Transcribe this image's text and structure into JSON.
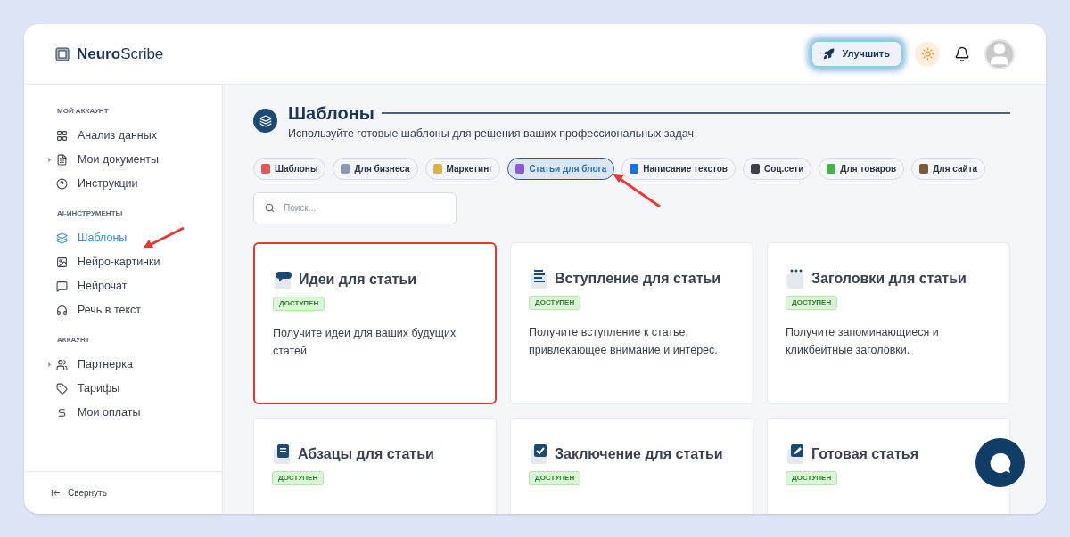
{
  "logo": {
    "bold": "Neuro",
    "light": "Scribe"
  },
  "header": {
    "upgrade_button": "Улучшить"
  },
  "sidebar": {
    "sections": [
      {
        "title": "МОЙ АККАУНТ",
        "items": [
          {
            "label": "Анализ данных",
            "kind": "grid",
            "expandable": false,
            "selected": false
          },
          {
            "label": "Мои документы",
            "kind": "doc",
            "expandable": true,
            "selected": false
          },
          {
            "label": "Инструкции",
            "kind": "help",
            "expandable": false,
            "selected": false
          }
        ]
      },
      {
        "title": "AI-ИНСТРУМЕНТЫ",
        "items": [
          {
            "label": "Шаблоны",
            "kind": "layers",
            "expandable": false,
            "selected": true
          },
          {
            "label": "Нейро-картинки",
            "kind": "image",
            "expandable": false,
            "selected": false
          },
          {
            "label": "Нейрочат",
            "kind": "chat",
            "expandable": false,
            "selected": false
          },
          {
            "label": "Речь в текст",
            "kind": "headphones",
            "expandable": false,
            "selected": false
          }
        ]
      },
      {
        "title": "АККАУНТ",
        "items": [
          {
            "label": "Партнерка",
            "kind": "users",
            "expandable": true,
            "selected": false
          },
          {
            "label": "Тарифы",
            "kind": "tag",
            "expandable": false,
            "selected": false
          },
          {
            "label": "Мои оплаты",
            "kind": "dollar",
            "expandable": false,
            "selected": false
          }
        ]
      }
    ],
    "collapse": "Свернуть"
  },
  "page": {
    "title": "Шаблоны",
    "subtitle": "Используйте готовые шаблоны для решения ваших профессиональных задач"
  },
  "categories": [
    {
      "label": "Шаблоны",
      "color": "#e05a5a",
      "selected": false
    },
    {
      "label": "Для бизнеса",
      "color": "#8a9bb0",
      "selected": false
    },
    {
      "label": "Маркетинг",
      "color": "#d9b24a",
      "selected": false
    },
    {
      "label": "Статьи для блога",
      "color": "#8e5bc9",
      "selected": true
    },
    {
      "label": "Написание текстов",
      "color": "#1e6fd9",
      "selected": false
    },
    {
      "label": "Соц.сети",
      "color": "#3a3f4a",
      "selected": false
    },
    {
      "label": "Для товаров",
      "color": "#4caf50",
      "selected": false
    },
    {
      "label": "Для сайта",
      "color": "#7a5a3a",
      "selected": false
    }
  ],
  "search": {
    "placeholder": "Поиск..."
  },
  "cards": [
    {
      "title": "Идеи для статьи",
      "kind": "bubble",
      "badge": "ДОСТУПЕН",
      "description": "Получите идеи для ваших будущих статей",
      "highlighted": true
    },
    {
      "title": "Вступление для статьи",
      "kind": "lines",
      "badge": "ДОСТУПЕН",
      "description": "Получите вступление к статье, привлекающее внимание и интерес.",
      "highlighted": false
    },
    {
      "title": "Заголовки для статьи",
      "kind": "dots",
      "badge": "ДОСТУПЕН",
      "description": "Получите запоминающиеся и кликбейтные заголовки.",
      "highlighted": false
    },
    {
      "title": "Абзацы для статьи",
      "kind": "book",
      "badge": "ДОСТУПЕН",
      "highlighted": false
    },
    {
      "title": "Заключение для статьи",
      "kind": "check",
      "badge": "ДОСТУПЕН",
      "highlighted": false
    },
    {
      "title": "Готовая статья",
      "kind": "pen",
      "badge": "ДОСТУПЕН",
      "highlighted": false
    }
  ]
}
